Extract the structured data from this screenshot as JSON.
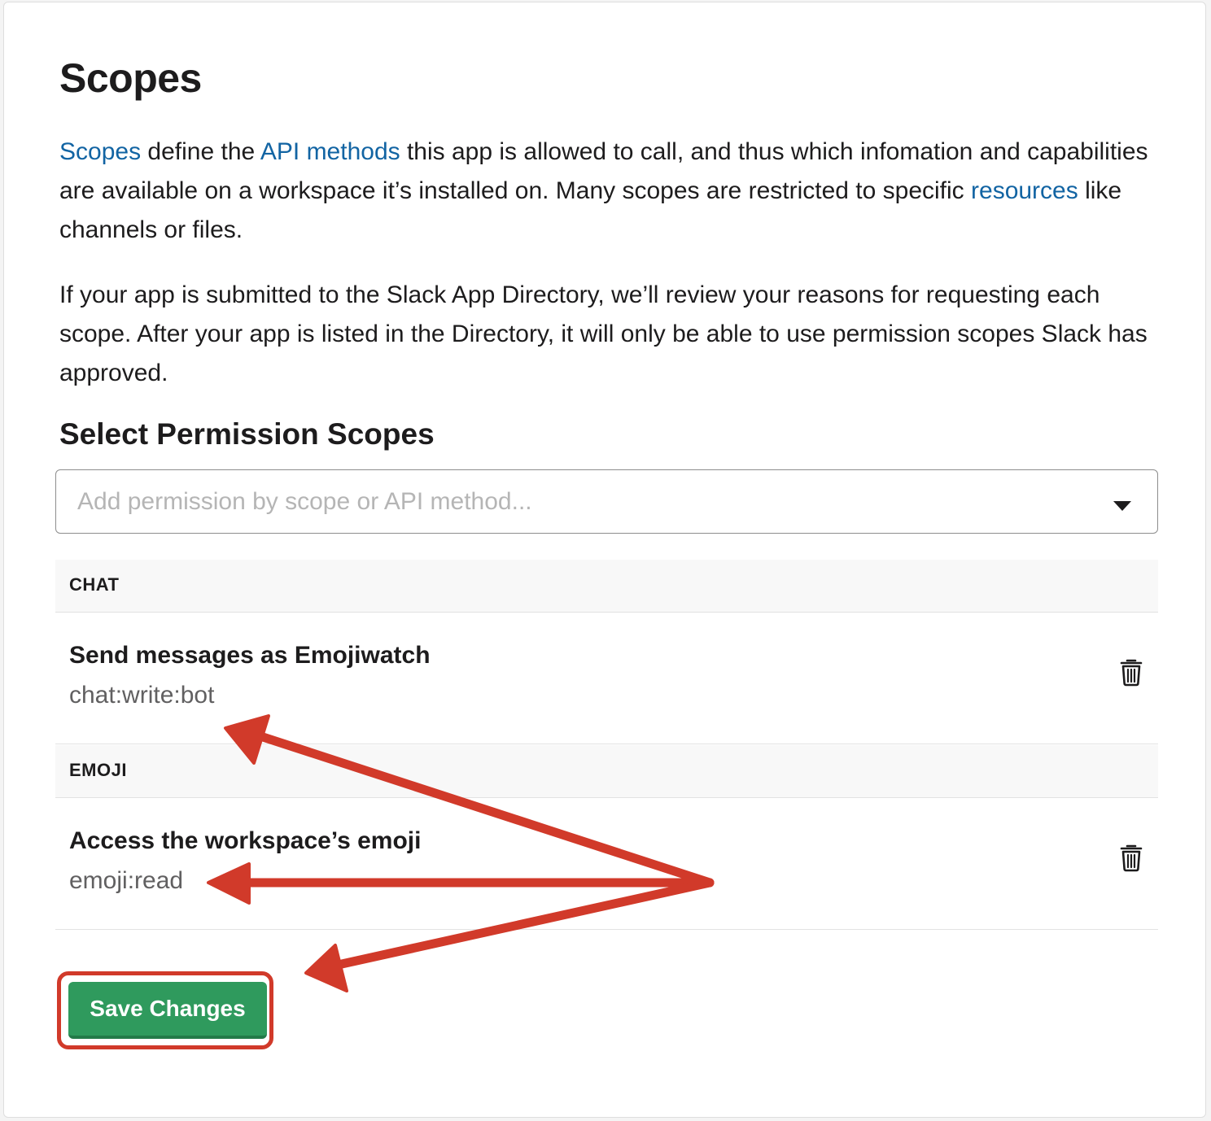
{
  "page": {
    "title": "Scopes",
    "intro": {
      "link_scopes": "Scopes",
      "text_1": " define the ",
      "link_api_methods": "API methods",
      "text_2": " this app is allowed to call, and thus which infomation and capabilities are available on a workspace it’s installed on. Many scopes are restricted to specific ",
      "link_resources": "resources",
      "text_3": " like channels or files."
    },
    "review_note": "If your app is submitted to the Slack App Directory, we’ll review your reasons for requesting each scope. After your app is listed in the Directory, it will only be able to use permission scopes Slack has approved."
  },
  "permissions": {
    "heading": "Select Permission Scopes",
    "search_placeholder": "Add permission by scope or API method...",
    "groups": [
      {
        "label": "CHAT",
        "scopes": [
          {
            "name": "Send messages as Emojiwatch",
            "code": "chat:write:bot",
            "remove_icon": "trash-icon"
          }
        ]
      },
      {
        "label": "EMOJI",
        "scopes": [
          {
            "name": "Access the workspace’s emoji",
            "code": "emoji:read",
            "remove_icon": "trash-icon"
          }
        ]
      }
    ]
  },
  "actions": {
    "save_label": "Save Changes"
  },
  "colors": {
    "link": "#1264a3",
    "save_button": "#2f9a5d",
    "annotation": "#d13a2a"
  }
}
